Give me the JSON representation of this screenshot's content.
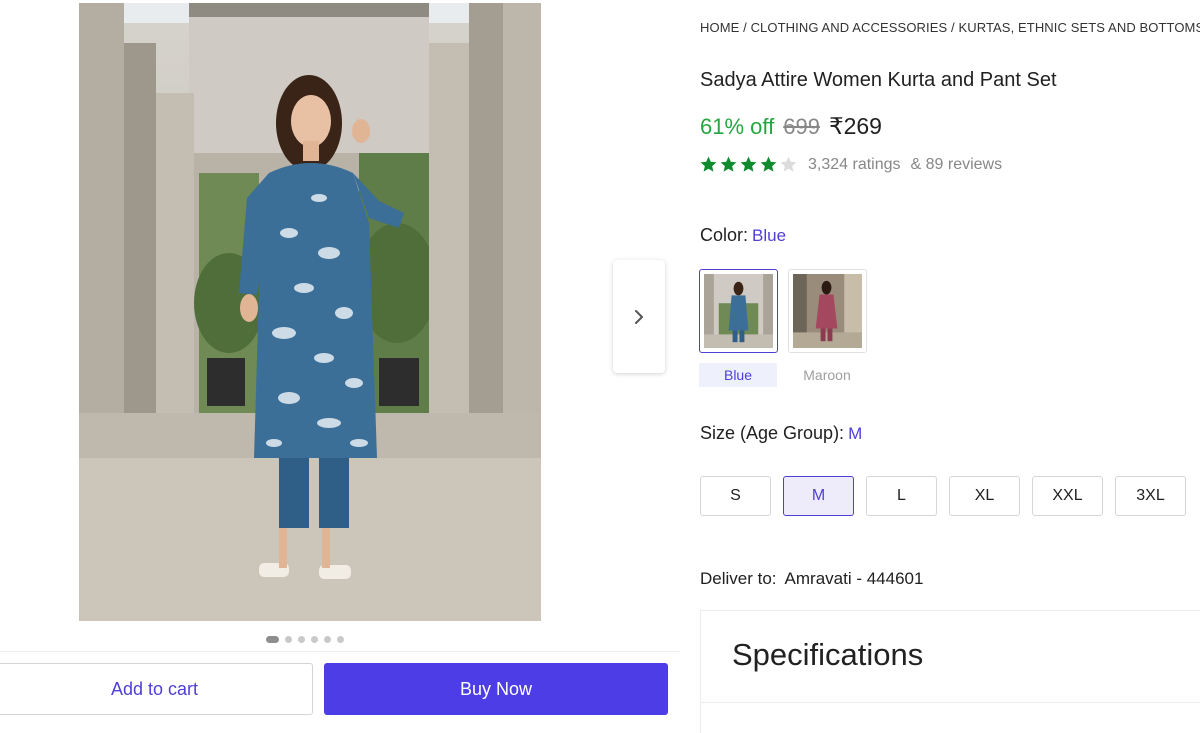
{
  "breadcrumb": {
    "items": [
      "HOME",
      "CLOTHING AND ACCESSORIES",
      "KURTAS, ETHNIC SETS AND BOTTOMS"
    ],
    "separator": "/"
  },
  "product": {
    "title": "Sadya Attire Women Kurta and Pant Set",
    "discount": "61% off",
    "mrp": "699",
    "price": "₹269",
    "rating_stars": 4,
    "rating_max": 5,
    "ratings_text": "3,324 ratings",
    "reviews_text": "& 89 reviews"
  },
  "gallery": {
    "image_count": 6,
    "active_index": 0,
    "next_icon": "chevron-right-icon"
  },
  "color": {
    "label": "Color:",
    "selected": "Blue",
    "options": [
      {
        "label": "Blue",
        "selected": true
      },
      {
        "label": "Maroon",
        "selected": false
      }
    ]
  },
  "size": {
    "label": "Size (Age Group):",
    "selected": "M",
    "options": [
      "S",
      "M",
      "L",
      "XL",
      "XXL",
      "3XL"
    ]
  },
  "delivery": {
    "label": "Deliver to:",
    "location": "Amravati - 444601"
  },
  "specifications": {
    "title": "Specifications"
  },
  "actions": {
    "add_to_cart": "Add to cart",
    "buy_now": "Buy Now"
  },
  "colors": {
    "accent": "#4d3de6",
    "link": "#4f3fd6",
    "discount": "#26a541",
    "star": "#0f8a2e",
    "muted": "#878787"
  }
}
